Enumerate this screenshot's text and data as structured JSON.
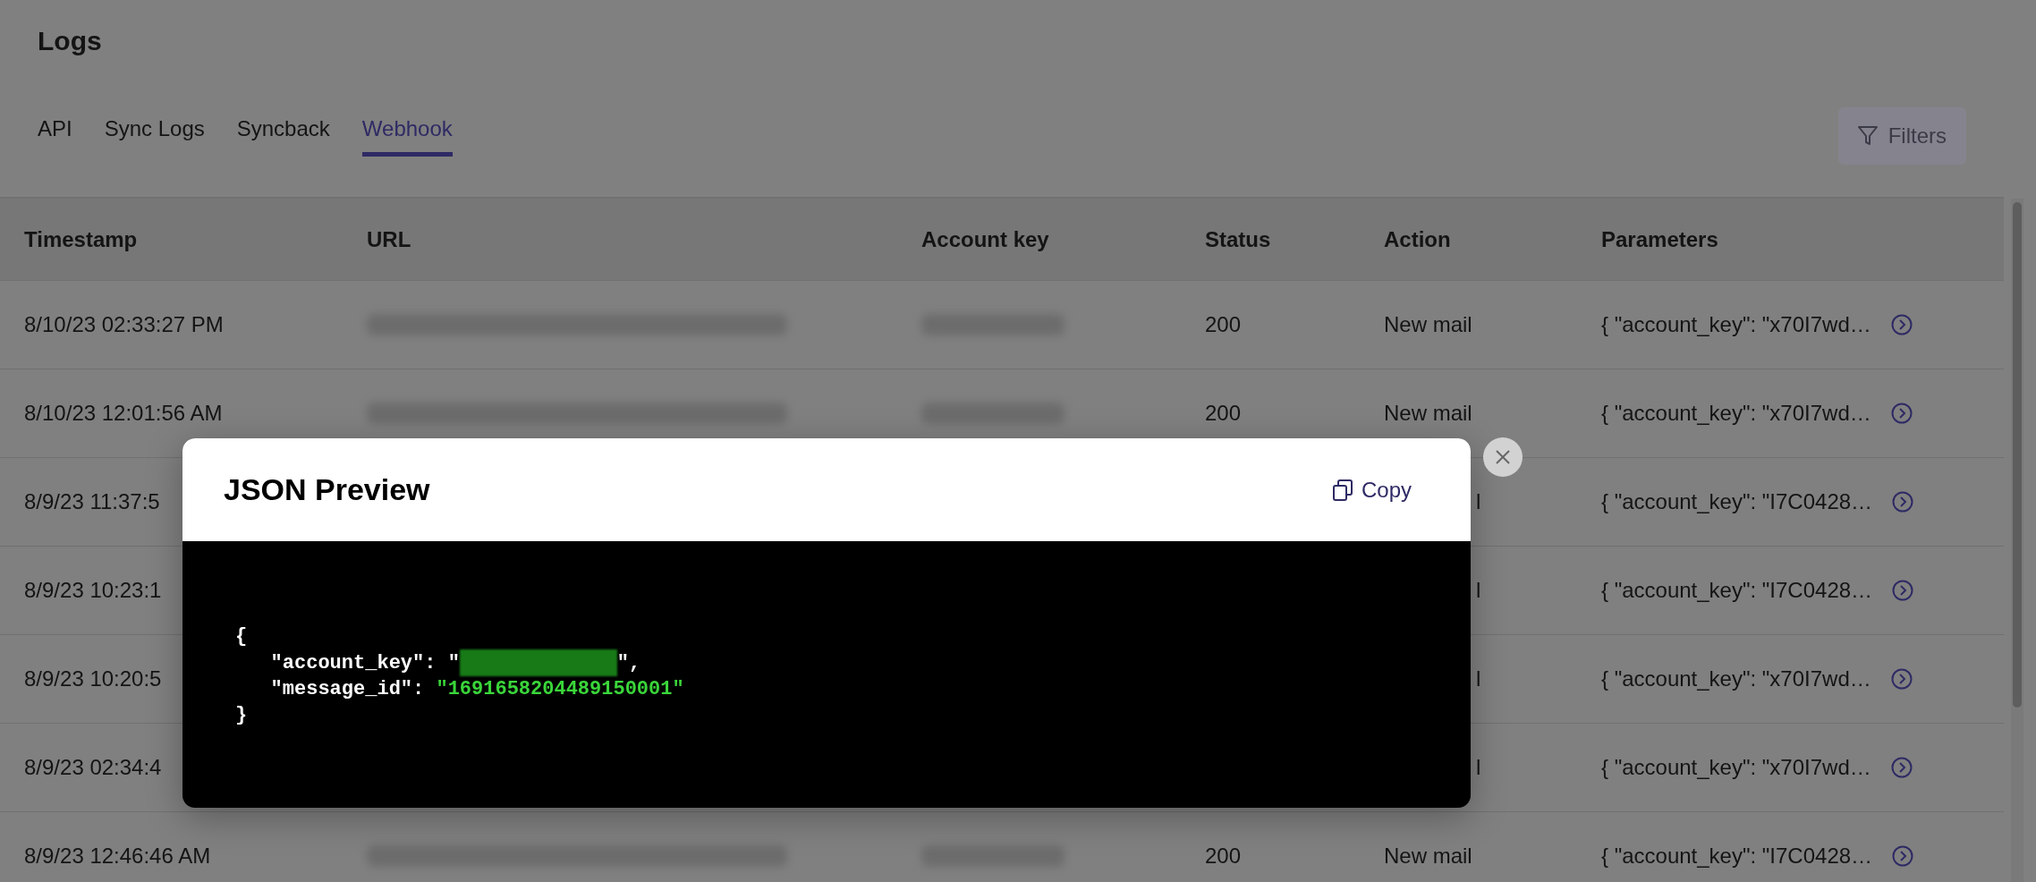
{
  "page": {
    "title": "Logs"
  },
  "tabs": [
    {
      "label": "API",
      "selected": false
    },
    {
      "label": "Sync Logs",
      "selected": false
    },
    {
      "label": "Syncback",
      "selected": false
    },
    {
      "label": "Webhook",
      "selected": true
    }
  ],
  "filters_button": {
    "label": "Filters"
  },
  "table": {
    "columns": [
      "Timestamp",
      "URL",
      "Account key",
      "Status",
      "Action",
      "Parameters"
    ],
    "rows": [
      {
        "timestamp": "8/10/23 02:33:27 PM",
        "status": "200",
        "action": "New mail",
        "parameters": "{ \"account_key\": \"x70I7wd…"
      },
      {
        "timestamp": "8/10/23 12:01:56 AM",
        "status": "200",
        "action": "New mail",
        "parameters": "{ \"account_key\": \"x70I7wd…"
      },
      {
        "timestamp": "8/9/23 11:37:5",
        "action": "l",
        "parameters": "{ \"account_key\": \"I7C0428…"
      },
      {
        "timestamp": "8/9/23 10:23:1",
        "action": "l",
        "parameters": "{ \"account_key\": \"I7C0428…"
      },
      {
        "timestamp": "8/9/23 10:20:5",
        "action": "l",
        "parameters": "{ \"account_key\": \"x70I7wd…"
      },
      {
        "timestamp": "8/9/23 02:34:4",
        "action": "l",
        "parameters": "{ \"account_key\": \"x70I7wd…"
      },
      {
        "timestamp": "8/9/23 12:46:46 AM",
        "status": "200",
        "action": "New mail",
        "parameters": "{ \"account_key\": \"I7C0428…"
      }
    ]
  },
  "modal": {
    "title": "JSON Preview",
    "copy_button": "Copy",
    "code": {
      "open": "{",
      "close": "}",
      "entries": [
        {
          "key": "\"account_key\":",
          "value_before": "\"",
          "redacted": true,
          "value_after": "\","
        },
        {
          "key": "\"message_id\":",
          "value": "\"1691658204489150001\""
        }
      ]
    }
  }
}
